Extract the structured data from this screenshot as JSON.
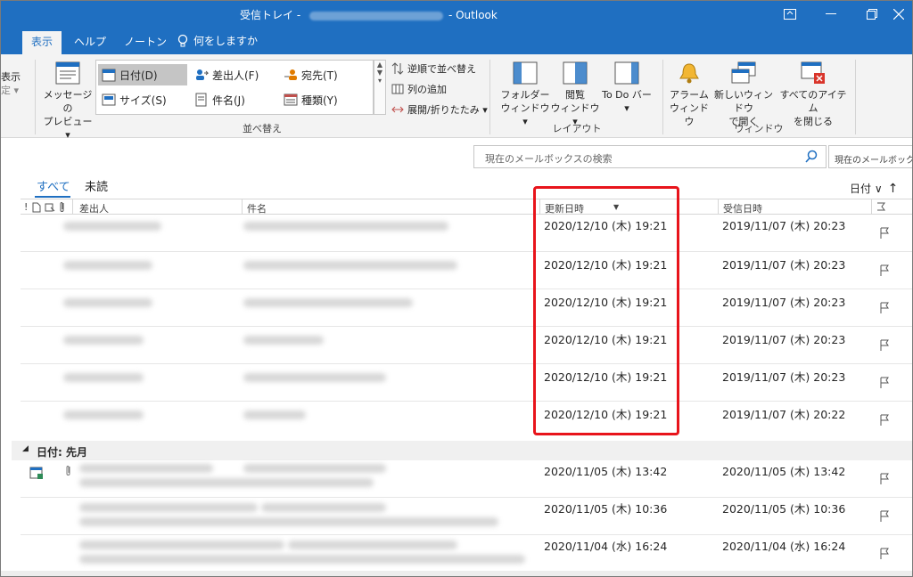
{
  "window": {
    "title_prefix": "受信トレイ - ",
    "title_suffix": "- Outlook"
  },
  "ribbon_tabs": [
    {
      "label": "表示",
      "active": true
    },
    {
      "label": "ヘルプ",
      "active": false
    },
    {
      "label": "ノートン",
      "active": false
    }
  ],
  "tell_me": "何をしますか",
  "ribbon": {
    "left_partial_top": "表示",
    "left_partial_bottom": "定 ▾",
    "message_preview": {
      "line1": "メッセージの",
      "line2": "プレビュー ▾"
    },
    "arrangement": [
      "日付(D)",
      "差出人(F)",
      "宛先(T)",
      "サイズ(S)",
      "件名(J)",
      "種類(Y)"
    ],
    "sort_links": [
      "逆順で並べ替え",
      "列の追加",
      "展開/折りたたみ ▾"
    ],
    "group_sort_label": "並べ替え",
    "layout": [
      {
        "line1": "フォルダー",
        "line2": "ウィンドウ ▾"
      },
      {
        "line1": "閲覧",
        "line2": "ウィンドウ ▾"
      },
      {
        "line1": "To Do バー",
        "line2": "▾"
      }
    ],
    "group_layout_label": "レイアウト",
    "window_group": [
      {
        "line1": "アラーム",
        "line2": "ウィンドウ"
      },
      {
        "line1": "新しいウィンドウ",
        "line2": "で開く"
      },
      {
        "line1": "すべてのアイテム",
        "line2": "を閉じる"
      }
    ],
    "group_window_label": "ウィンドウ"
  },
  "search": {
    "placeholder": "現在のメールボックスの検索",
    "scope": "現在のメールボックス"
  },
  "filters": [
    "すべて",
    "未読"
  ],
  "sort_control": {
    "label": "日付 ∨",
    "arrow": "↑"
  },
  "columns": {
    "icons": "!",
    "from": "差出人",
    "subject": "件名",
    "modified": "更新日時",
    "received": "受信日時"
  },
  "rows": [
    {
      "modified": "2020/12/10 (木) 19:21",
      "received": "2019/11/07 (木) 20:23"
    },
    {
      "modified": "2020/12/10 (木) 19:21",
      "received": "2019/11/07 (木) 20:23"
    },
    {
      "modified": "2020/12/10 (木) 19:21",
      "received": "2019/11/07 (木) 20:23"
    },
    {
      "modified": "2020/12/10 (木) 19:21",
      "received": "2019/11/07 (木) 20:23"
    },
    {
      "modified": "2020/12/10 (木) 19:21",
      "received": "2019/11/07 (木) 20:23"
    },
    {
      "modified": "2020/12/10 (木) 19:21",
      "received": "2019/11/07 (木) 20:22"
    }
  ],
  "group_header": "日付: 先月",
  "rows2": [
    {
      "modified": "2020/11/05 (木) 13:42",
      "received": "2020/11/05 (木) 13:42"
    },
    {
      "modified": "2020/11/05 (木) 10:36",
      "received": "2020/11/05 (木) 10:36"
    },
    {
      "modified": "2020/11/04 (水) 16:24",
      "received": "2020/11/04 (水) 16:24"
    }
  ],
  "colors": {
    "accent": "#1f6fc1",
    "highlight": "#e8141b"
  }
}
